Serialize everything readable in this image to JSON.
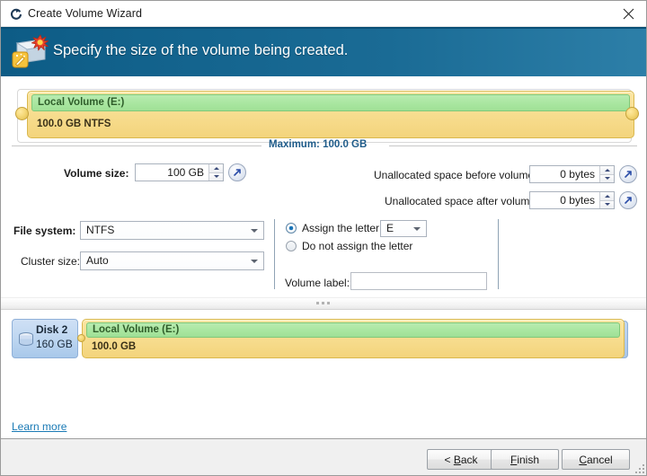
{
  "window": {
    "title": "Create Volume Wizard",
    "title_icon": "volume-wizard-icon",
    "close_icon": "close-icon"
  },
  "banner": {
    "heading": "Specify the size of the volume being created.",
    "icon": "create-volume-icon",
    "bg_color": "#14648e"
  },
  "volume_slider": {
    "volume_name": "Local Volume (E:)",
    "volume_size_text": "100.0 GB NTFS",
    "maximum_label": "Maximum: 100.0 GB",
    "left_handle": "slider-handle-left",
    "right_handle": "slider-handle-right",
    "green_color": "#a9e6a0",
    "yellow_color": "#f7dc8d"
  },
  "form": {
    "volume_size_label": "Volume size:",
    "volume_size_value": "100 GB",
    "unalloc_before_label": "Unallocated space before volume:",
    "unalloc_before_value": "0 bytes",
    "unalloc_after_label": "Unallocated space after volume:",
    "unalloc_after_value": "0 bytes",
    "file_system_label": "File system:",
    "file_system_value": "NTFS",
    "cluster_size_label": "Cluster size:",
    "cluster_size_value": "Auto",
    "assign_letter_label": "Assign the letter:",
    "assign_letter_value": "E",
    "do_not_assign_label": "Do not assign the letter",
    "volume_label_label": "Volume label:",
    "volume_label_value": "",
    "volume_label_placeholder": ""
  },
  "disk_map": {
    "disk_name": "Disk 2",
    "disk_capacity": "160 GB",
    "volume_name": "Local Volume (E:)",
    "volume_size": "100.0 GB",
    "disk_icon": "disk-stack-icon"
  },
  "links": {
    "learn_more": "Learn more"
  },
  "footer": {
    "back_label": "< Back",
    "back_accel": "B",
    "finish_label": "Finish",
    "finish_accel": "F",
    "cancel_label": "Cancel",
    "cancel_accel": "C"
  }
}
